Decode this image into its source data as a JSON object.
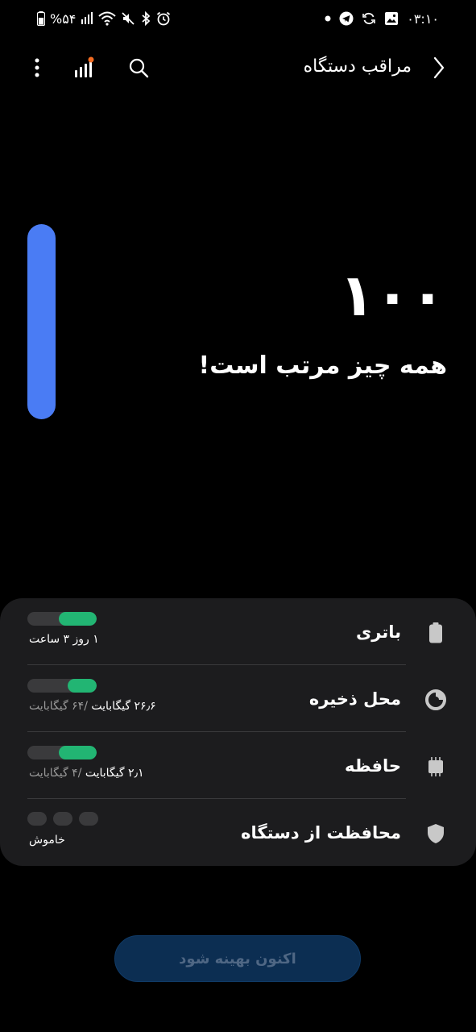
{
  "status_bar": {
    "battery_text": "%۵۴",
    "time": "۰۳:۱۰"
  },
  "header": {
    "title": "مراقب دستگاه"
  },
  "score": {
    "value": "۱۰۰",
    "message": "همه چیز مرتب است!",
    "level": 1.0,
    "color": "#4a7cf4"
  },
  "items": [
    {
      "label": "باتری",
      "value": "۱ روز ۳ ساعت",
      "value_muted": "",
      "icon": "battery-icon",
      "fill": 0.55
    },
    {
      "label": "محل ذخیره",
      "value": "۲۶٫۶ گیگابایت",
      "value_muted": " /۶۴ گیگابایت",
      "icon": "storage-pie-icon",
      "fill": 0.42
    },
    {
      "label": "حافظه",
      "value": "۲٫۱ گیگابایت",
      "value_muted": " /۴ گیگابایت",
      "icon": "memory-chip-icon",
      "fill": 0.55
    },
    {
      "label": "محافظت از دستگاه",
      "value": "خاموش",
      "value_muted": "",
      "icon": "shield-icon",
      "fill": 0
    }
  ],
  "optimize_button": {
    "label": "اکنون بهینه شود"
  },
  "colors": {
    "accent_green": "#22b573",
    "track": "#3a3a3c",
    "card_bg": "#1c1c1e",
    "button_bg": "#0c2e52"
  }
}
